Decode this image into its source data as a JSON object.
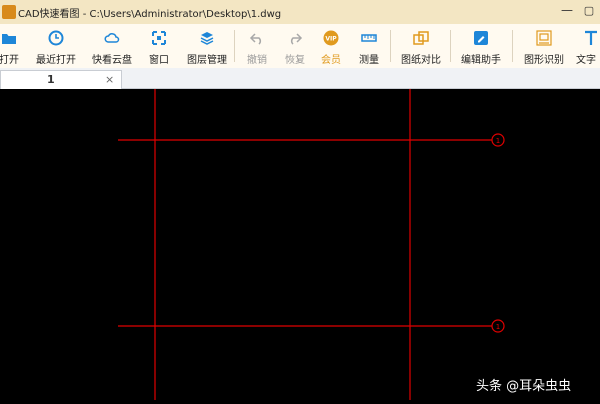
{
  "window": {
    "title": "CAD快速看图 - C:\\Users\\Administrator\\Desktop\\1.dwg"
  },
  "toolbar": {
    "items": [
      {
        "label": "打开",
        "icon": "folder-open-icon"
      },
      {
        "label": "最近打开",
        "icon": "clock-icon"
      },
      {
        "label": "快看云盘",
        "icon": "cloud-icon"
      },
      {
        "label": "窗口",
        "icon": "window-frame-icon"
      },
      {
        "label": "图层管理",
        "icon": "layers-icon"
      },
      {
        "label": "撤销",
        "icon": "undo-icon"
      },
      {
        "label": "恢复",
        "icon": "redo-icon"
      },
      {
        "label": "会员",
        "icon": "vip-icon"
      },
      {
        "label": "测量",
        "icon": "ruler-icon"
      },
      {
        "label": "图纸对比",
        "icon": "compare-icon"
      },
      {
        "label": "编辑助手",
        "icon": "edit-assistant-icon"
      },
      {
        "label": "图形识别",
        "icon": "shape-recognition-icon"
      },
      {
        "label": "文字",
        "icon": "text-icon"
      }
    ]
  },
  "tabs": [
    {
      "label": "1",
      "close": "×"
    }
  ],
  "drawing": {
    "axis_labels": [
      "1",
      "1"
    ],
    "line_color": "#e00000",
    "background": "#000000"
  },
  "watermark": "头条 @耳朵虫虫",
  "colors": {
    "titlebar": "#f3e6c3",
    "toolbar": "#fffaf0",
    "accent_blue": "#1e86d8",
    "vip_orange": "#e09a1e"
  }
}
